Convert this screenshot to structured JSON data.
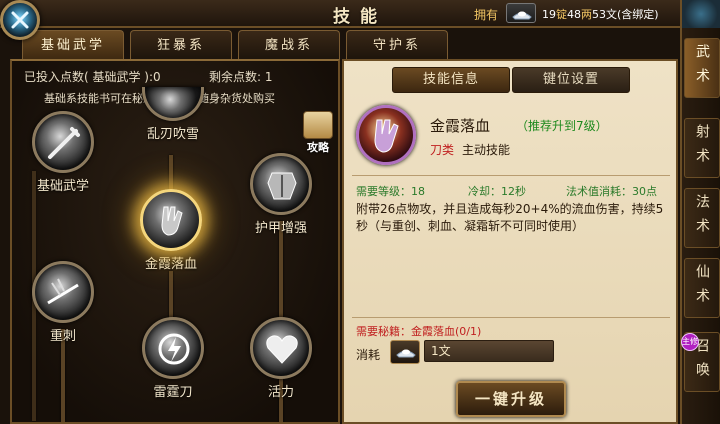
{
  "header": {
    "title": "技能",
    "wealth_label": "拥有",
    "ingot_amount": "19",
    "ingot_unit": "锭",
    "tael_amount": "48",
    "tael_unit": "两",
    "coin_amount": "53",
    "coin_unit": "文(含绑定)"
  },
  "tabs": [
    {
      "label": "基础武学",
      "active": true
    },
    {
      "label": "狂暴系",
      "active": false
    },
    {
      "label": "魔战系",
      "active": false
    },
    {
      "label": "守护系",
      "active": false
    }
  ],
  "left_panel": {
    "invested": "已投入点数( 基础武学 ):0",
    "remaining": "剩余点数: 1",
    "hint": "基础系技能书可在秘籍收藏家或随身杂货处购买",
    "strategy_label": "攻略",
    "skills": [
      {
        "label": "基础武学"
      },
      {
        "label": "乱刃吹雪"
      },
      {
        "label": "护甲增强"
      },
      {
        "label": "金霞落血",
        "selected": true
      },
      {
        "label": "重刺"
      },
      {
        "label": "雷霆刀"
      },
      {
        "label": "活力"
      }
    ]
  },
  "right_panel": {
    "tabs": [
      {
        "label": "技能信息",
        "active": true
      },
      {
        "label": "键位设置",
        "active": false
      }
    ],
    "skill_name": "金霞落血",
    "recommend": "（推荐升到7级）",
    "category": "刀类",
    "skill_type": "主动技能",
    "required_level": "需要等级：18",
    "cooldown": "冷却：12秒",
    "mana_cost": "法术值消耗：30点",
    "description": "附带26点物攻，并且造成每秒20+4%的流血伤害，持续5秒（与重创、刺血、凝霜斩不可同时使用）",
    "book_required": "需要秘籍：金霞落血(0/1)",
    "cost_label": "消耗",
    "cost_value": "1文",
    "upgrade_button": "一键升级"
  },
  "side_tabs": [
    {
      "label": "武术",
      "active": true
    },
    {
      "label": "射术",
      "active": false
    },
    {
      "label": "法术",
      "active": false
    },
    {
      "label": "仙术",
      "active": false
    },
    {
      "label": "召唤",
      "active": false,
      "badge": "主修"
    }
  ]
}
